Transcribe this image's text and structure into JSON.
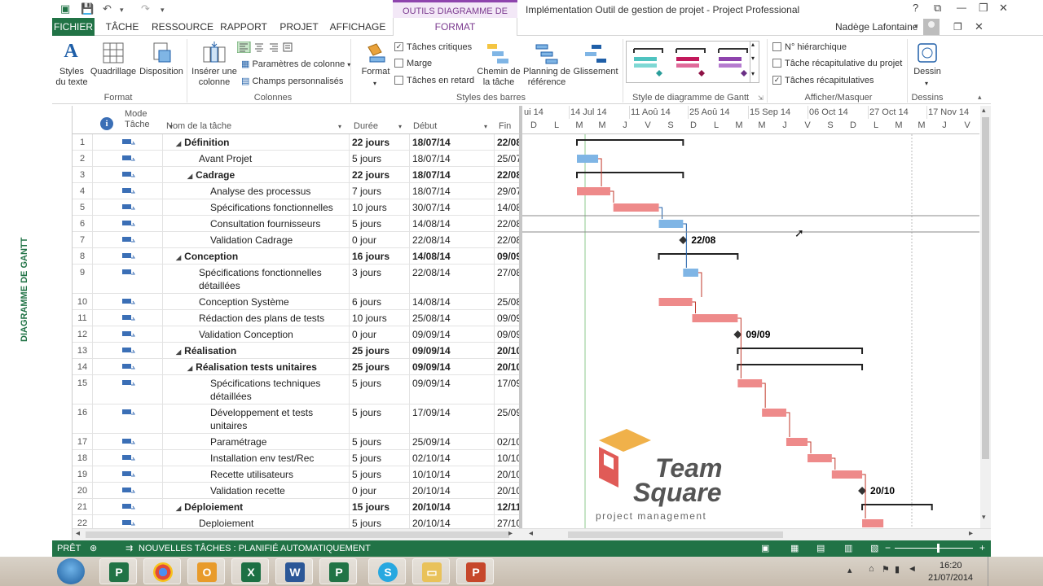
{
  "titlebar": {
    "context_tab": "OUTILS DIAGRAMME DE GANTT",
    "window_title": "Implémentation Outil de gestion de projet - Project Professional",
    "help": "?",
    "minimize": "🗕",
    "restore": "🗗",
    "close": "✕"
  },
  "tabs": [
    "FICHIER",
    "TÂCHE",
    "RESSOURCE",
    "RAPPORT",
    "PROJET",
    "AFFICHAGE",
    "FORMAT"
  ],
  "user": {
    "name": "Nadège Lafontaine"
  },
  "ribbon": {
    "format_group": {
      "styles_texte": "Styles\ndu texte",
      "quadrillage": "Quadrillage",
      "disposition": "Disposition",
      "label": "Format"
    },
    "colonnes_group": {
      "inserer_colonne": "Insérer une\ncolonne",
      "parametres_colonne": "Paramètres de colonne",
      "champs_personnalises": "Champs personnalisés",
      "label": "Colonnes"
    },
    "styles_barres_group": {
      "taches_critiques": "Tâches critiques",
      "marge": "Marge",
      "taches_en_retard": "Tâches en retard",
      "format": "Format",
      "chemin_tache": "Chemin de\nla tâche",
      "planning_reference": "Planning de\nréférence",
      "glissement": "Glissement",
      "label": "Styles des barres"
    },
    "style_diagramme_group": {
      "label": "Style de diagramme de Gantt"
    },
    "afficher_group": {
      "no_hierarchique": "N° hiérarchique",
      "tache_recap_projet": "Tâche récapitulative du projet",
      "taches_recapitulatives": "Tâches récapitulatives",
      "label": "Afficher/Masquer"
    },
    "dessins_group": {
      "dessin": "Dessin",
      "label": "Dessins"
    }
  },
  "sidebar_label": "DIAGRAMME DE GANTT",
  "grid_headers": {
    "mode": "Mode\nTâche",
    "name": "Nom de la tâche",
    "duree": "Durée",
    "debut": "Début",
    "fin": "Fin"
  },
  "timeline": {
    "weeks": [
      "ui 14",
      "14 Jul 14",
      "11 Aoû 14",
      "25 Aoû 14",
      "15 Sep 14",
      "06 Oct 14",
      "27 Oct 14",
      "17 Nov 14"
    ],
    "days": [
      "D",
      "L",
      "M",
      "M",
      "J",
      "V",
      "S",
      "D",
      "L",
      "M",
      "M",
      "J",
      "V",
      "S",
      "D",
      "L",
      "M",
      "M",
      "J",
      "V"
    ]
  },
  "tasks": [
    {
      "id": "1",
      "name": "Définition",
      "duree": "22 jours",
      "debut": "18/07/14",
      "fin": "22/08",
      "level": 0,
      "summary": true
    },
    {
      "id": "2",
      "name": "Avant Projet",
      "duree": "5 jours",
      "debut": "18/07/14",
      "fin": "25/07",
      "level": 1,
      "summary": false
    },
    {
      "id": "3",
      "name": "Cadrage",
      "duree": "22 jours",
      "debut": "18/07/14",
      "fin": "22/08",
      "level": 1,
      "summary": true
    },
    {
      "id": "4",
      "name": "Analyse des processus",
      "duree": "7 jours",
      "debut": "18/07/14",
      "fin": "29/07",
      "level": 2,
      "summary": false
    },
    {
      "id": "5",
      "name": "Spécifications fonctionnelles",
      "duree": "10 jours",
      "debut": "30/07/14",
      "fin": "14/08",
      "level": 2,
      "summary": false
    },
    {
      "id": "6",
      "name": "Consultation fournisseurs",
      "duree": "5 jours",
      "debut": "14/08/14",
      "fin": "22/08",
      "level": 2,
      "summary": false
    },
    {
      "id": "7",
      "name": "Validation Cadrage",
      "duree": "0 jour",
      "debut": "22/08/14",
      "fin": "22/08",
      "level": 2,
      "summary": false
    },
    {
      "id": "8",
      "name": "Conception",
      "duree": "16 jours",
      "debut": "14/08/14",
      "fin": "09/09",
      "level": 0,
      "summary": true
    },
    {
      "id": "9",
      "name": "Spécifications fonctionnelles\ndétaillées",
      "duree": "3 jours",
      "debut": "22/08/14",
      "fin": "27/08",
      "level": 1,
      "summary": false
    },
    {
      "id": "10",
      "name": "Conception Système",
      "duree": "6 jours",
      "debut": "14/08/14",
      "fin": "25/08",
      "level": 1,
      "summary": false
    },
    {
      "id": "11",
      "name": "Rédaction des plans de tests",
      "duree": "10 jours",
      "debut": "25/08/14",
      "fin": "09/09",
      "level": 1,
      "summary": false
    },
    {
      "id": "12",
      "name": "Validation Conception",
      "duree": "0 jour",
      "debut": "09/09/14",
      "fin": "09/09",
      "level": 1,
      "summary": false
    },
    {
      "id": "13",
      "name": "Réalisation",
      "duree": "25 jours",
      "debut": "09/09/14",
      "fin": "20/10",
      "level": 0,
      "summary": true
    },
    {
      "id": "14",
      "name": "Réalisation tests unitaires",
      "duree": "25 jours",
      "debut": "09/09/14",
      "fin": "20/10",
      "level": 1,
      "summary": true
    },
    {
      "id": "15",
      "name": "Spécifications techniques\ndétaillées",
      "duree": "5 jours",
      "debut": "09/09/14",
      "fin": "17/09",
      "level": 2,
      "summary": false
    },
    {
      "id": "16",
      "name": "Développement et  tests\nunitaires",
      "duree": "5 jours",
      "debut": "17/09/14",
      "fin": "25/09",
      "level": 2,
      "summary": false
    },
    {
      "id": "17",
      "name": "Paramétrage",
      "duree": "5 jours",
      "debut": "25/09/14",
      "fin": "02/10",
      "level": 2,
      "summary": false
    },
    {
      "id": "18",
      "name": "Installation env test/Rec",
      "duree": "5 jours",
      "debut": "02/10/14",
      "fin": "10/10",
      "level": 2,
      "summary": false
    },
    {
      "id": "19",
      "name": "Recette utilisateurs",
      "duree": "5 jours",
      "debut": "10/10/14",
      "fin": "20/10",
      "level": 2,
      "summary": false
    },
    {
      "id": "20",
      "name": "Validation recette",
      "duree": "0 jour",
      "debut": "20/10/14",
      "fin": "20/10",
      "level": 2,
      "summary": false
    },
    {
      "id": "21",
      "name": "Déploiement",
      "duree": "15 jours",
      "debut": "20/10/14",
      "fin": "12/11",
      "level": 0,
      "summary": true
    },
    {
      "id": "22",
      "name": "Deploiement",
      "duree": "5 jours",
      "debut": "20/10/14",
      "fin": "27/10",
      "level": 1,
      "summary": false
    }
  ],
  "milestones": [
    "22/08",
    "09/09",
    "20/10"
  ],
  "watermark": {
    "line1": "Team",
    "line2": "Square",
    "line3": "project management"
  },
  "statusbar": {
    "ready": "PRÊT",
    "new_tasks": "NOUVELLES TÂCHES : PLANIFIÉ AUTOMATIQUEMENT"
  },
  "taskbar": {
    "time": "16:20",
    "date": "21/07/2014"
  },
  "colors": {
    "accent": "#217346",
    "critical": "#ee8a8a",
    "normal": "#7fb5e5",
    "context": "#7b3a8f"
  }
}
